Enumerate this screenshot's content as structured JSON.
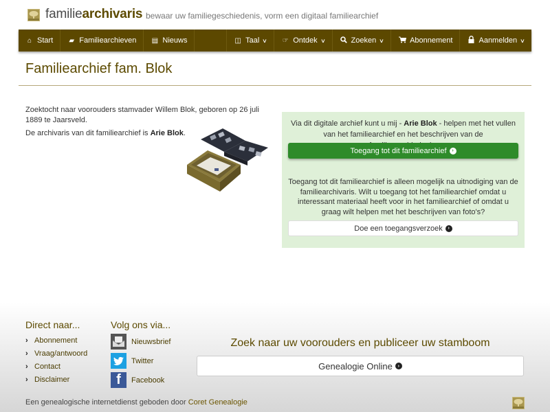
{
  "header": {
    "brand_light": "familie",
    "brand_bold": "archivaris",
    "tagline": "bewaar uw familiegeschiedenis, vorm een digitaal familiearchief"
  },
  "nav": {
    "left": [
      {
        "label": "Start",
        "icon": "home-icon"
      },
      {
        "label": "Familiearchieven",
        "icon": "book-icon"
      },
      {
        "label": "Nieuws",
        "icon": "newspaper-icon"
      }
    ],
    "right": [
      {
        "label": "Taal",
        "icon": "language-icon",
        "dropdown": true
      },
      {
        "label": "Ontdek",
        "icon": "hand-pointer-icon",
        "dropdown": true
      },
      {
        "label": "Zoeken",
        "icon": "search-icon",
        "dropdown": true
      },
      {
        "label": "Abonnement",
        "icon": "cart-icon",
        "dropdown": false
      },
      {
        "label": "Aanmelden",
        "icon": "lock-icon",
        "dropdown": true
      }
    ]
  },
  "page": {
    "title": "Familiearchief fam. Blok",
    "intro": "Zoektocht naar voorouders stamvader Willem Blok, geboren op 26 juli 1889 te Jaarsveld.",
    "archivist_prefix": "De archivaris van dit familiearchief is ",
    "archivist_name": "Arie Blok",
    "archivist_suffix": "."
  },
  "panel": {
    "text1_prefix": "Via dit digitale archief kunt u mij - ",
    "text1_name": "Arie Blok",
    "text1_suffix": " - helpen met het vullen van het familiearchief en het beschrijven van de familiegeschiedenis.",
    "access_button": "Toegang tot dit familiearchief",
    "text2": "Toegang tot dit familiearchief is alleen mogelijk na uitnodiging van de familiearchivaris. Wilt u toegang tot het familiearchief omdat u interessant materiaal heeft voor in het familiearchief of omdat u graag wilt helpen met het beschrijven van foto's?",
    "request_button": "Doe een toegangsverzoek"
  },
  "footer": {
    "direct_heading": "Direct naar...",
    "direct_links": [
      "Abonnement",
      "Vraag/antwoord",
      "Contact",
      "Disclaimer"
    ],
    "follow_heading": "Volg ons via...",
    "social": [
      {
        "label": "Nieuwsbrief",
        "icon": "newsletter-icon",
        "color": "#555555"
      },
      {
        "label": "Twitter",
        "icon": "twitter-icon",
        "color": "#1da1e2"
      },
      {
        "label": "Facebook",
        "icon": "facebook-icon",
        "color": "#3b5998"
      }
    ],
    "promo_title": "Zoek naar uw voorouders en publiceer uw stamboom",
    "promo_button": "Genealogie Online",
    "credit_prefix": "Een genealogische internetdienst geboden door ",
    "credit_link": "Coret Genealogie"
  },
  "colors": {
    "brand": "#5c4800",
    "accent_text": "#5c4a00",
    "success_button": "#2e8b2a",
    "panel_bg": "#dff0d8"
  }
}
